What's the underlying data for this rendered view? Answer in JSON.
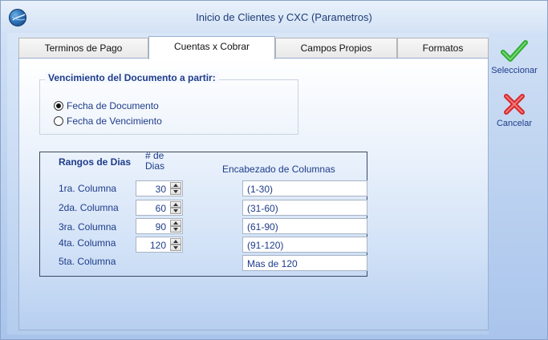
{
  "window": {
    "title": "Inicio de Clientes y CXC (Parametros)"
  },
  "tabs": [
    {
      "label": "Terminos de Pago",
      "active": false
    },
    {
      "label": "Cuentas x Cobrar",
      "active": true
    },
    {
      "label": "Campos Propios",
      "active": false
    },
    {
      "label": "Formatos",
      "active": false
    }
  ],
  "vencimiento": {
    "title": "Vencimiento del Documento a partir:",
    "options": [
      {
        "label": "Fecha de Documento",
        "checked": true
      },
      {
        "label": "Fecha de Vencimiento",
        "checked": false
      }
    ]
  },
  "ranges": {
    "header_rangos": "Rangos de Dias",
    "header_dias": "# de\nDias",
    "header_encabezado": "Encabezado de Columnas",
    "rows": [
      {
        "label": "1ra. Columna",
        "days": "30",
        "heading": "(1-30)"
      },
      {
        "label": "2da. Columna",
        "days": "60",
        "heading": "(31-60)"
      },
      {
        "label": "3ra. Columna",
        "days": "90",
        "heading": "(61-90)"
      },
      {
        "label": "4ta. Columna",
        "days": "120",
        "heading": "(91-120)"
      },
      {
        "label": "5ta. Columna",
        "days": null,
        "heading": "Mas de 120"
      }
    ]
  },
  "actions": {
    "select_label": "Seleccionar",
    "cancel_label": "Cancelar",
    "select_color": "#2fae2f",
    "cancel_color": "#d8282a"
  }
}
